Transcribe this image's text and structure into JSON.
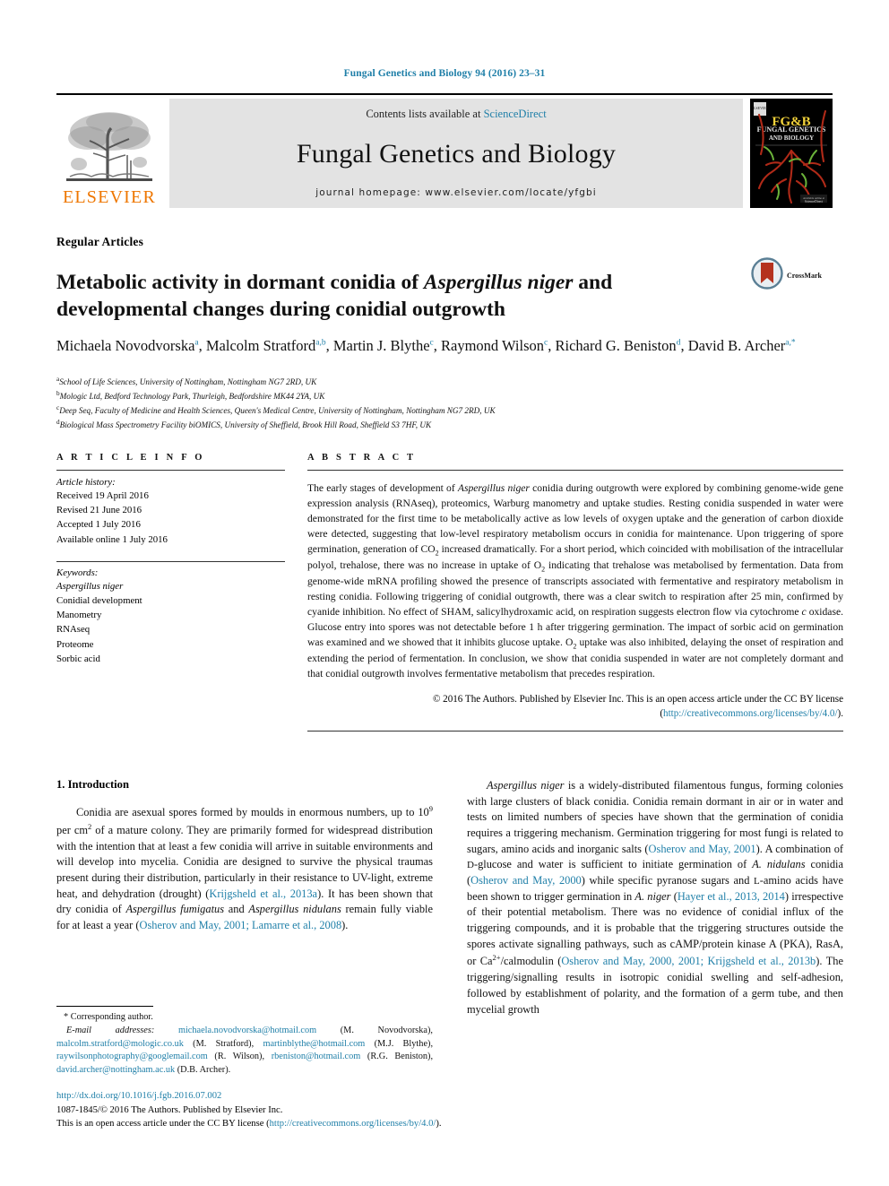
{
  "running_head": "Fungal Genetics and Biology 94 (2016) 23–31",
  "masthead": {
    "contents_prefix": "Contents lists available at ",
    "sciencedirect": "ScienceDirect",
    "journal_name": "Fungal Genetics and Biology",
    "homepage": "journal homepage: www.elsevier.com/locate/yfgbi",
    "publisher_wordmark": "ELSEVIER",
    "publisher_logo_icon": "elsevier-tree-icon",
    "cover_title_line1": "FG&B",
    "cover_title_line2": "FUNGAL GENETICS",
    "cover_title_line3": "AND BIOLOGY"
  },
  "title_block": {
    "kicker": "Regular Articles",
    "title_part1": "Metabolic activity in dormant conidia of ",
    "title_italic": "Aspergillus niger",
    "title_part2": " and developmental changes during conidial outgrowth",
    "crossmark_label": "CrossMark",
    "crossmark_icon": "crossmark-icon"
  },
  "authors": [
    {
      "name": "Michaela Novodvorska",
      "sup": "a",
      "sep": ", "
    },
    {
      "name": "Malcolm Stratford",
      "sup": "a,b",
      "sep": ", "
    },
    {
      "name": "Martin J. Blythe",
      "sup": "c",
      "sep": ", "
    },
    {
      "name": "Raymond Wilson",
      "sup": "c",
      "sep": ", "
    },
    {
      "name": "Richard G. Beniston",
      "sup": "d",
      "sep": ", "
    },
    {
      "name": "David B. Archer",
      "sup": "a,*",
      "sep": ""
    }
  ],
  "affiliations": [
    {
      "marker": "a",
      "text": "School of Life Sciences, University of Nottingham, Nottingham NG7 2RD, UK"
    },
    {
      "marker": "b",
      "text": "Mologic Ltd, Bedford Technology Park, Thurleigh, Bedfordshire MK44 2YA, UK"
    },
    {
      "marker": "c",
      "text": "Deep Seq, Faculty of Medicine and Health Sciences, Queen's Medical Centre, University of Nottingham, Nottingham NG7 2RD, UK"
    },
    {
      "marker": "d",
      "text": "Biological Mass Spectrometry Facility biOMICS, University of Sheffield, Brook Hill Road, Sheffield S3 7HF, UK"
    }
  ],
  "article_info": {
    "heading": "A R T I C L E  I N F O",
    "history_title": "Article history:",
    "history": [
      "Received 19 April 2016",
      "Revised 21 June 2016",
      "Accepted 1 July 2016",
      "Available online 1 July 2016"
    ],
    "keywords_title": "Keywords:",
    "keywords": [
      "Aspergillus niger",
      "Conidial development",
      "Manometry",
      "RNAseq",
      "Proteome",
      "Sorbic acid"
    ]
  },
  "abstract": {
    "heading": "A B S T R A C T",
    "copyright_text": "© 2016 The Authors. Published by Elsevier Inc. This is an open access article under the CC BY license (",
    "copyright_link": "http://creativecommons.org/licenses/by/4.0/",
    "copyright_tail": ")."
  },
  "introduction": {
    "heading": "1. Introduction"
  },
  "footnote": {
    "corresponding": "* Corresponding author.",
    "email_label": "E-mail addresses:",
    "emails": [
      {
        "address": "michaela.novodvorska@hotmail.com",
        "who": "(M. Novodvorska)"
      },
      {
        "address": "malcolm.stratford@mologic.co.uk",
        "who": "(M. Stratford)"
      },
      {
        "address": "martinblythe@hotmail.com",
        "who": "(M.J. Blythe)"
      },
      {
        "address": "raywilsonphotography@googlemail.com",
        "who": "(R. Wilson)"
      },
      {
        "address": "rbeniston@hotmail.com",
        "who": "(R.G. Beniston)"
      },
      {
        "address": "david.archer@nottingham.ac.uk",
        "who": "(D.B. Archer)"
      }
    ]
  },
  "colophon": {
    "doi": "http://dx.doi.org/10.1016/j.fgb.2016.07.002",
    "issn_line": "1087-1845/© 2016 The Authors. Published by Elsevier Inc.",
    "license_prefix": "This is an open access article under the CC BY license (",
    "license_link": "http://creativecommons.org/licenses/by/4.0/",
    "license_tail": ")."
  },
  "colors": {
    "link": "#1f7fa8",
    "elsevier_orange": "#ee7600",
    "band_gray": "#e3e3e3"
  }
}
